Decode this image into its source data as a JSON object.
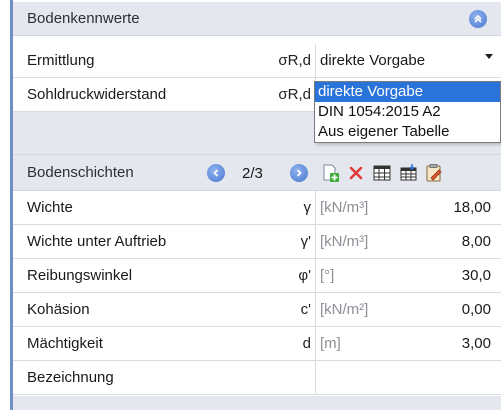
{
  "soil": {
    "section_title": "Bodenkennwerte",
    "rows": [
      {
        "label": "Ermittlung",
        "symbol": "σR,d",
        "value": "direkte Vorgabe"
      },
      {
        "label": "Sohldruckwiderstand",
        "symbol": "σR,d"
      }
    ],
    "dropdown_options": [
      "direkte Vorgabe",
      "DIN 1054:2015 A2",
      "Aus eigener Tabelle"
    ]
  },
  "layers": {
    "section_title": "Bodenschichten",
    "pager": "2/3",
    "rows": [
      {
        "label": "Wichte",
        "symbol": "γ",
        "unit": "[kN/m³]",
        "value": "18,00"
      },
      {
        "label": "Wichte unter Auftrieb",
        "symbol": "γ'",
        "unit": "[kN/m³]",
        "value": "8,00"
      },
      {
        "label": "Reibungswinkel",
        "symbol": "φ'",
        "unit": "[°]",
        "value": "30,0"
      },
      {
        "label": "Kohäsion",
        "symbol": "c'",
        "unit": "[kN/m²]",
        "value": "0,00"
      },
      {
        "label": "Mächtigkeit",
        "symbol": "d",
        "unit": "[m]",
        "value": "3,00"
      },
      {
        "label": "Bezeichnung",
        "symbol": "",
        "unit": "",
        "value": ""
      }
    ]
  },
  "colors": {
    "accent_blue": "#4a78cf",
    "selection_blue": "#2a73d9",
    "header_gray": "#e4e7ee",
    "border_blue": "#6f8fc6"
  }
}
